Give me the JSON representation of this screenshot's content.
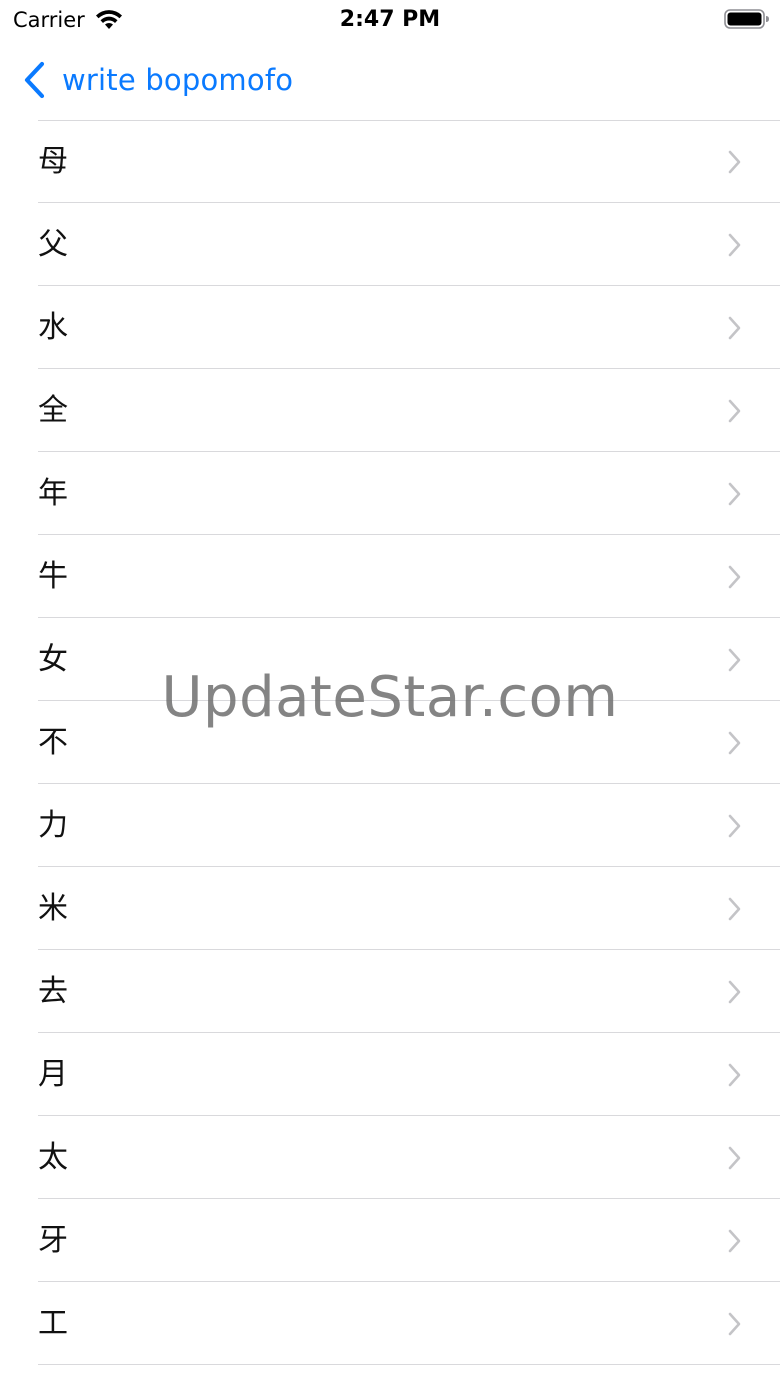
{
  "status_bar": {
    "carrier": "Carrier",
    "time": "2:47 PM",
    "wifi_icon": "wifi-icon",
    "battery_icon": "battery-icon"
  },
  "nav": {
    "back_label": "write bopomofo",
    "back_icon": "chevron-left-icon",
    "accent_color": "#0a7aff"
  },
  "list": {
    "items": [
      {
        "label": "母"
      },
      {
        "label": "父"
      },
      {
        "label": "水"
      },
      {
        "label": "全"
      },
      {
        "label": "年"
      },
      {
        "label": "牛"
      },
      {
        "label": "女"
      },
      {
        "label": "不"
      },
      {
        "label": "力"
      },
      {
        "label": "米"
      },
      {
        "label": "去"
      },
      {
        "label": "月"
      },
      {
        "label": "太"
      },
      {
        "label": "牙"
      },
      {
        "label": "工"
      }
    ],
    "disclosure_icon": "chevron-right-icon"
  },
  "watermark": {
    "text": "UpdateStar.com"
  }
}
